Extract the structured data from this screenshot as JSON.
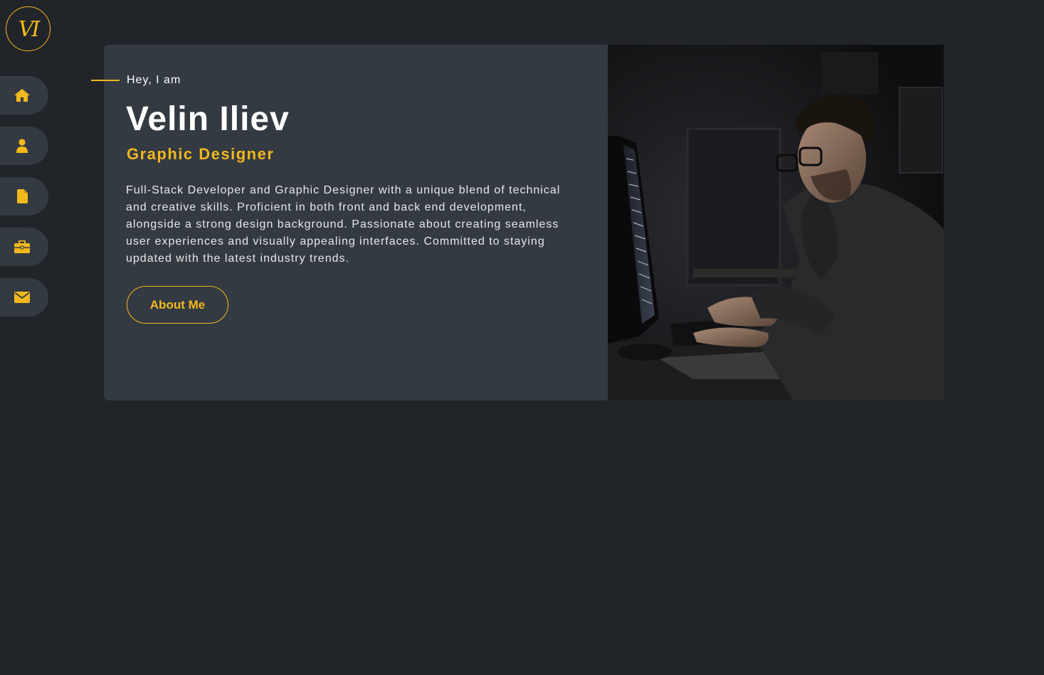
{
  "brand": {
    "logo_text": "VI",
    "accent_color": "#f2b91d"
  },
  "nav": {
    "items": [
      {
        "icon": "home-icon"
      },
      {
        "icon": "user-icon"
      },
      {
        "icon": "file-icon"
      },
      {
        "icon": "briefcase-icon"
      },
      {
        "icon": "envelope-icon"
      }
    ]
  },
  "hero": {
    "eyebrow": "Hey, I am",
    "name": "Velin Iliev",
    "role": "Graphic Designer",
    "bio": "Full-Stack Developer and Graphic Designer with a unique blend of technical and creative skills. Proficient in both front and back end development, alongside a strong design background. Passionate about creating seamless user experiences and visually appealing interfaces. Committed to staying updated with the latest industry trends.",
    "cta_label": "About Me"
  },
  "colors": {
    "page_bg": "#212429",
    "card_bg": "#343a42",
    "accent": "#f2b91d"
  }
}
